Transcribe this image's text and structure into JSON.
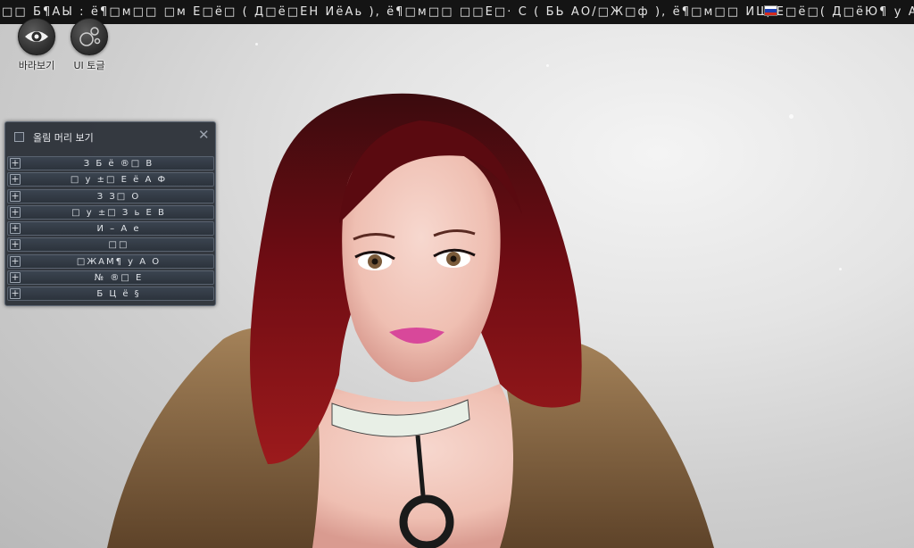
{
  "topbar": {
    "text": "□□ Б¶АЫ : ё¶□м□□ □м Е□ё□ ( Д□ё□ЕН ИёАь ), ё¶□м□□ □□Е□· С ( БЬ АО/□Ж□ф ), ё¶□м□□ ИЩ Е□ё□( Д□ёЮ¶ у А§Д□ АМ□",
    "flag_colors": [
      "#ffffff",
      "#1c3fb5",
      "#d52b1e"
    ]
  },
  "buttons": {
    "look": {
      "label": "바라보기",
      "icon": "eye-icon"
    },
    "ui_toggle": {
      "label": "UI 토글",
      "icon": "bubbles-icon"
    }
  },
  "panel": {
    "title": "올림 머리 보기",
    "close_glyph": "✕",
    "checkbox_checked": false,
    "items": [
      {
        "label": "З Б ё ®□ В"
      },
      {
        "label": "□ у ±□ Е ё А Ф"
      },
      {
        "label": "З З□ О"
      },
      {
        "label": "□ у ±□ З ь Е В"
      },
      {
        "label": "И – А е"
      },
      {
        "label": "□□"
      },
      {
        "label": "□ЖАМ¶ у А О"
      },
      {
        "label": "№ ®□ Е"
      },
      {
        "label": "Б Ц ё §"
      }
    ]
  },
  "colors": {
    "panel_bg": "#222830",
    "hair": "#7d0c12",
    "fur": "#8a6a45",
    "skin": "#f2c9bd"
  }
}
